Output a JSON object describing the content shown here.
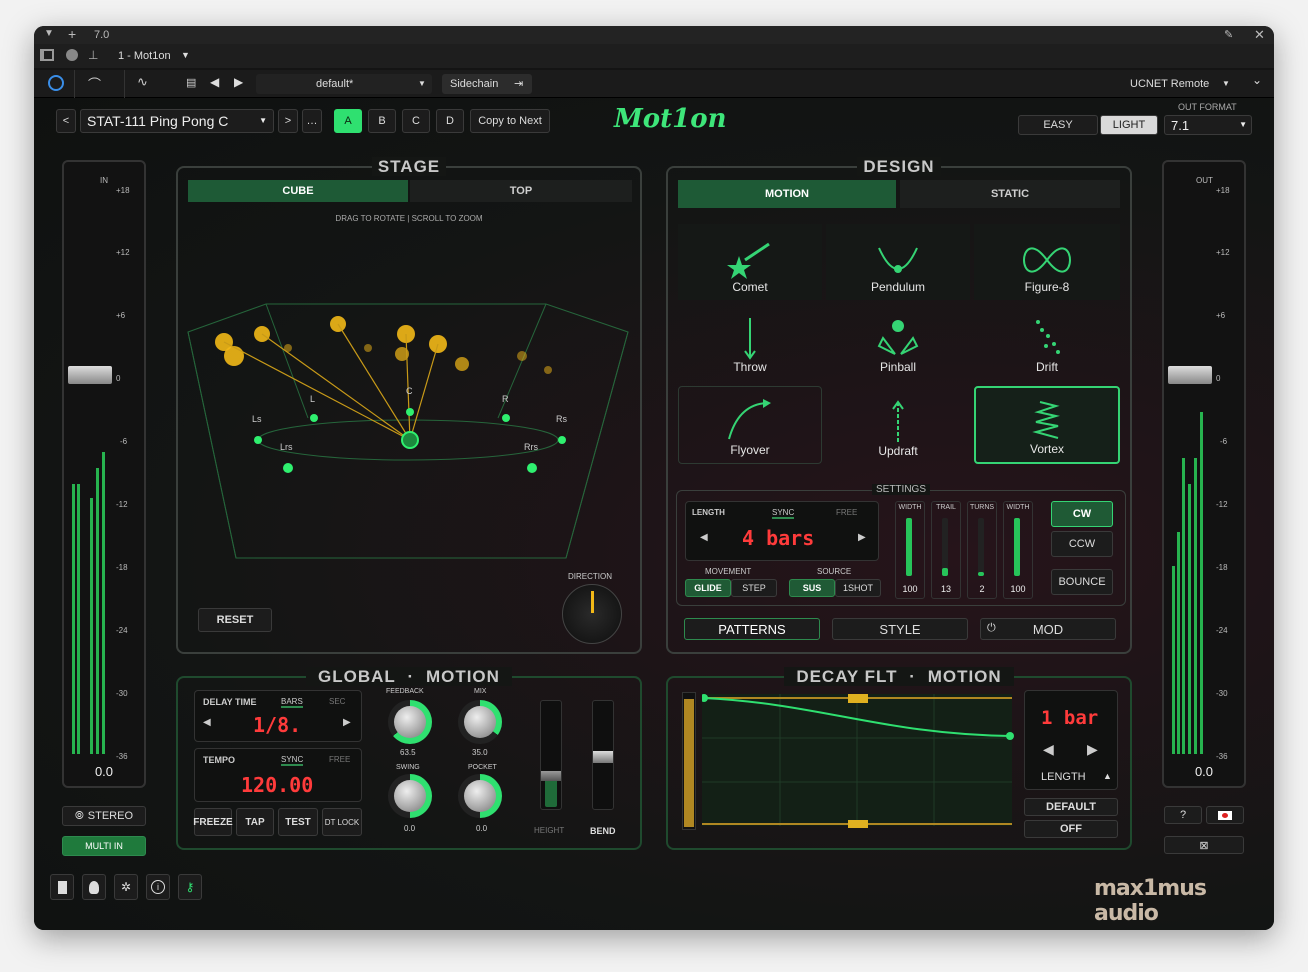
{
  "host": {
    "version": "7.0",
    "track": "1 - Mot1on",
    "preset_file": "default*",
    "sidechain": "Sidechain",
    "remote": "UCNET Remote"
  },
  "plugin": {
    "preset_name": "STAT-111 Ping Pong C",
    "ab": [
      "A",
      "B",
      "C",
      "D"
    ],
    "copy_next": "Copy to Next",
    "logo": "Mot1on",
    "mode_easy": "EASY",
    "mode_light": "LIGHT",
    "out_format_label": "OUT FORMAT",
    "out_format": "7.1",
    "brand": "max1mus audio"
  },
  "meters": {
    "in_label": "IN",
    "out_label": "OUT",
    "scale": [
      "+18",
      "+12",
      "+6",
      "0",
      "-6",
      "-12",
      "-18",
      "-24",
      "-30",
      "-36"
    ],
    "in_value": "0.0",
    "out_value": "0.0",
    "stereo": "STEREO",
    "multi_in": "MULTI IN"
  },
  "stage": {
    "title": "STAGE",
    "tabs": [
      "CUBE",
      "TOP"
    ],
    "hint": "DRAG TO ROTATE | SCROLL TO ZOOM",
    "reset": "RESET",
    "direction": "DIRECTION",
    "speakers": [
      "Ls",
      "L",
      "C",
      "R",
      "Rs",
      "Lrs",
      "Rrs"
    ]
  },
  "design": {
    "title": "DESIGN",
    "tabs": [
      "MOTION",
      "STATIC"
    ],
    "tiles": [
      "Comet",
      "Pendulum",
      "Figure-8",
      "Throw",
      "Pinball",
      "Drift",
      "Flyover",
      "Updraft",
      "Vortex"
    ],
    "settings_title": "SETTINGS",
    "length_label": "LENGTH",
    "sync": "SYNC",
    "free": "FREE",
    "length_value": "4 bars",
    "movement_label": "MOVEMENT",
    "movement_opts": [
      "GLIDE",
      "STEP"
    ],
    "source_label": "SOURCE",
    "source_opts": [
      "SUS",
      "1SHOT"
    ],
    "sliders": [
      {
        "label": "WIDTH",
        "value": "100",
        "level": 1.0
      },
      {
        "label": "TRAIL",
        "value": "13",
        "level": 0.13
      },
      {
        "label": "TURNS",
        "value": "2",
        "level": 0.05
      },
      {
        "label": "WIDTH",
        "value": "100",
        "level": 1.0
      }
    ],
    "dir_buttons": [
      "CW",
      "CCW",
      "BOUNCE"
    ],
    "bottom_tabs": [
      "PATTERNS",
      "STYLE",
      "MOD"
    ]
  },
  "global": {
    "title_a": "GLOBAL",
    "title_b": "MOTION",
    "delay_label": "DELAY TIME",
    "bars": "BARS",
    "sec": "SEC",
    "delay_value": "1/8.",
    "tempo_label": "TEMPO",
    "sync": "SYNC",
    "free": "FREE",
    "tempo_value": "120.00",
    "knobs": [
      {
        "label": "FEEDBACK",
        "value": "63.5"
      },
      {
        "label": "MIX",
        "value": "35.0"
      },
      {
        "label": "SWING",
        "value": "0.0"
      },
      {
        "label": "POCKET",
        "value": "0.0"
      }
    ],
    "buttons": [
      "FREEZE",
      "TAP",
      "TEST",
      "DT LOCK"
    ],
    "height": "HEIGHT",
    "bend": "BEND"
  },
  "decay": {
    "title_a": "DECAY FLT",
    "title_b": "MOTION",
    "length_value": "1 bar",
    "length_label": "LENGTH",
    "default": "DEFAULT",
    "off": "OFF"
  }
}
